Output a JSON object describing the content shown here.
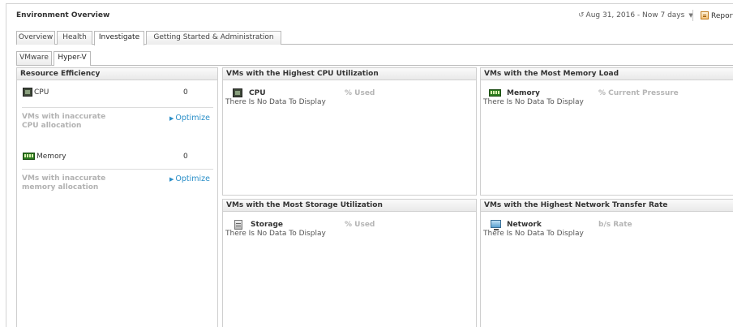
{
  "header": {
    "title": "Environment Overview",
    "date_range": "Aug 31, 2016 - Now 7 days",
    "reports_label": "Reports"
  },
  "tabs": [
    "Overview",
    "Health",
    "Investigate",
    "Getting Started & Administration"
  ],
  "active_tab": "Investigate",
  "subtabs": [
    "VMware",
    "Hyper-V"
  ],
  "active_subtab": "Hyper-V",
  "resource_efficiency": {
    "title": "Resource Efficiency",
    "cpu_label": "CPU",
    "cpu_value": "0",
    "cpu_note_line1": "VMs with inaccurate",
    "cpu_note_line2": "CPU allocation",
    "memory_label": "Memory",
    "memory_value": "0",
    "memory_note_line1": "VMs with inaccurate",
    "memory_note_line2": "memory allocation",
    "optimize_label": "Optimize"
  },
  "panels": {
    "cpu": {
      "title": "VMs with the Highest CPU Utilization",
      "metric": "CPU",
      "column": "% Used",
      "empty": "There Is No Data To Display",
      "icon": "cpu-icon"
    },
    "memory": {
      "title": "VMs with the Most Memory Load",
      "metric": "Memory",
      "column": "% Current Pressure",
      "empty": "There Is No Data To Display",
      "icon": "memory-icon"
    },
    "storage": {
      "title": "VMs with the Most Storage Utilization",
      "metric": "Storage",
      "column": "% Used",
      "empty": "There Is No Data To Display",
      "icon": "storage-icon"
    },
    "network": {
      "title": "VMs with the Highest Network Transfer Rate",
      "metric": "Network",
      "column": "b/s Rate",
      "empty": "There Is No Data To Display",
      "icon": "network-icon"
    }
  },
  "colors": {
    "link": "#2b8fc8",
    "muted": "#b2b2b2",
    "border": "#cfcfcf"
  }
}
